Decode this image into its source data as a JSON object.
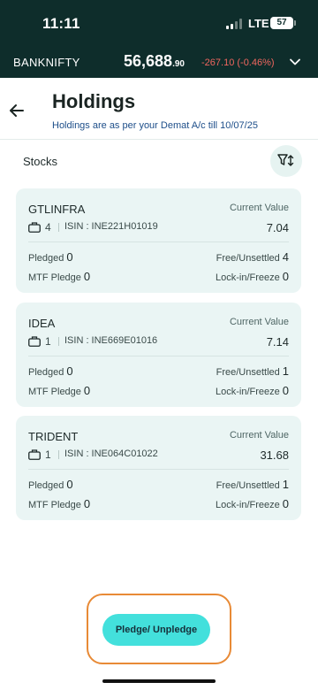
{
  "status_bar": {
    "time": "11:11",
    "network": "LTE",
    "battery": "57"
  },
  "ticker": {
    "name": "BANKNIFTY",
    "price_main": "56,688",
    "price_decimal": ".90",
    "change": "-267.10 (-0.46%)"
  },
  "header": {
    "title": "Holdings",
    "subtitle": "Holdings are as per your Demat A/c till 10/07/25"
  },
  "section": {
    "label": "Stocks"
  },
  "holdings": [
    {
      "name": "GTLINFRA",
      "qty": "4",
      "isin": "ISIN : INE221H01019",
      "current_value_label": "Current Value",
      "current_value": "7.04",
      "pledged_label": "Pledged",
      "pledged": "0",
      "free_label": "Free/Unsettled",
      "free": "4",
      "mtf_label": "MTF Pledge",
      "mtf": "0",
      "lockin_label": "Lock-in/Freeze",
      "lockin": "0"
    },
    {
      "name": "IDEA",
      "qty": "1",
      "isin": "ISIN : INE669E01016",
      "current_value_label": "Current Value",
      "current_value": "7.14",
      "pledged_label": "Pledged",
      "pledged": "0",
      "free_label": "Free/Unsettled",
      "free": "1",
      "mtf_label": "MTF Pledge",
      "mtf": "0",
      "lockin_label": "Lock-in/Freeze",
      "lockin": "0"
    },
    {
      "name": "TRIDENT",
      "qty": "1",
      "isin": "ISIN : INE064C01022",
      "current_value_label": "Current Value",
      "current_value": "31.68",
      "pledged_label": "Pledged",
      "pledged": "0",
      "free_label": "Free/Unsettled",
      "free": "1",
      "mtf_label": "MTF Pledge",
      "mtf": "0",
      "lockin_label": "Lock-in/Freeze",
      "lockin": "0"
    }
  ],
  "actions": {
    "pledge_label": "Pledge/ Unpledge"
  },
  "icons": {
    "back": "arrow-left-icon",
    "filter": "filter-sort-icon",
    "chevron": "chevron-down-icon",
    "briefcase": "briefcase-icon"
  },
  "colors": {
    "header_bg": "#0e2d2b",
    "card_bg": "#eaf5f4",
    "negative": "#f0665f",
    "button": "#43e0dc",
    "highlight": "#e88a36"
  }
}
